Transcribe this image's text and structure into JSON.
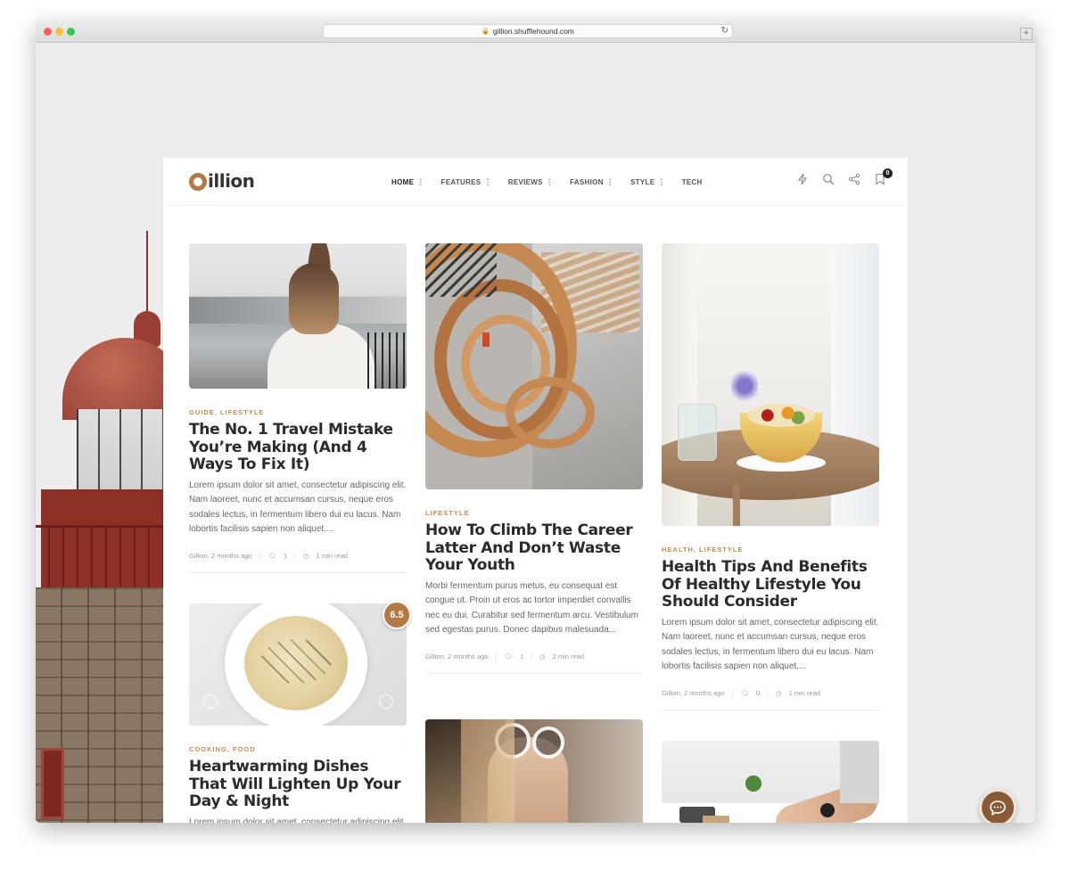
{
  "browser": {
    "url": "gillion.shufflehound.com"
  },
  "site": {
    "logo_text": "illion",
    "nav": [
      {
        "label": "HOME"
      },
      {
        "label": "FEATURES"
      },
      {
        "label": "REVIEWS"
      },
      {
        "label": "FASHION"
      },
      {
        "label": "STYLE"
      },
      {
        "label": "TECH"
      }
    ],
    "bookmark_count": "0"
  },
  "posts": [
    {
      "category": "GUIDE, LIFESTYLE",
      "title": "The No. 1 Travel Mistake You’re Making (And 4 Ways To Fix It)",
      "excerpt": "Lorem ipsum dolor sit amet, consectetur adipiscing elit. Nam laoreet, nunc et accumsan cursus, neque eros sodales lectus, in fermentum libero dui eu lacus. Nam lobortis facilisis sapien non aliquet....",
      "author_date": "Gillion, 2 months ago",
      "comments": "1",
      "read_time": "1 min read"
    },
    {
      "category": "COOKING, FOOD",
      "title": "Heartwarming Dishes That Will Lighten Up Your Day & Night",
      "excerpt": "Lorem ipsum dolor sit amet, consectetur adipiscing elit. Nam laoreet, nunc et accumsan cursus, neque",
      "score": "6.5"
    },
    {
      "category": "LIFESTYLE",
      "title": "How To Climb The Career Latter And Don’t Waste Your Youth",
      "excerpt": "Morbi fermentum purus metus, eu consequat est congue ut. Proin ut eros ac tortor imperdiet convallis nec eu dui. Curabitur sed fermentum arcu. Vestibulum sed egestas purus. Donec dapibus malesuada...",
      "author_date": "Gillion, 2 months ago",
      "comments": "1",
      "read_time": "2 min read"
    },
    {
      "category": "HEALTH, LIFESTYLE",
      "title": "Health Tips And Benefits Of Healthy Lifestyle You Should Consider",
      "excerpt": "Lorem ipsum dolor sit amet, consectetur adipiscing elit. Nam laoreet, nunc et accumsan cursus, neque eros sodales lectus, in fermentum libero dui eu lacus. Nam lobortis facilisis sapien non aliquet....",
      "author_date": "Gillion, 2 months ago",
      "comments": "0",
      "read_time": "1 min read"
    }
  ]
}
